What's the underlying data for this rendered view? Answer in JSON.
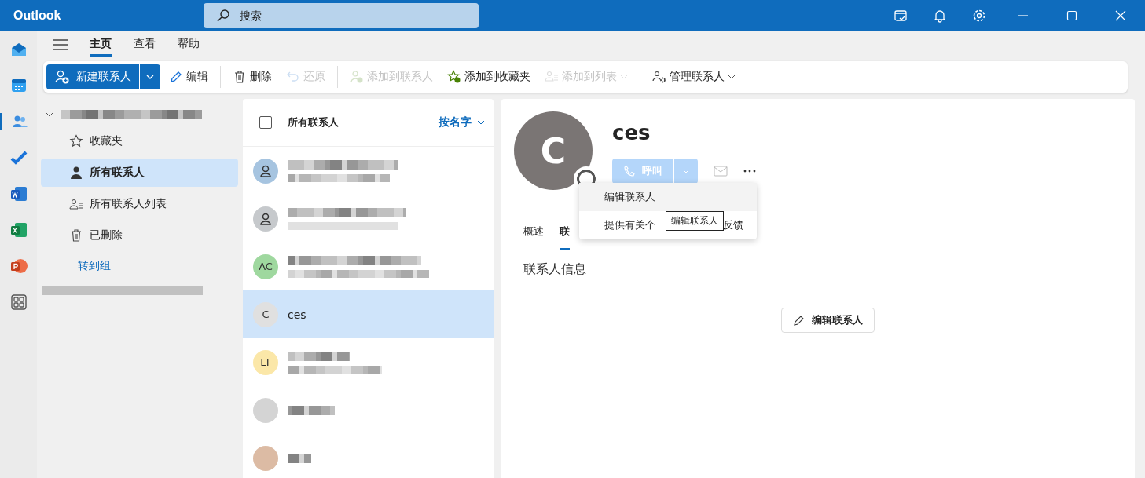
{
  "app": {
    "title": "Outlook"
  },
  "search": {
    "placeholder": "搜索"
  },
  "tabs": [
    {
      "label": "主页",
      "selected": true
    },
    {
      "label": "查看",
      "selected": false
    },
    {
      "label": "帮助",
      "selected": false
    }
  ],
  "ribbon_groups": [
    [
      {
        "kind": "new",
        "label": "新建联系人",
        "disabled": false,
        "dropdown": true
      },
      {
        "kind": "edit",
        "label": "编辑",
        "disabled": false,
        "dropdown": false
      }
    ],
    [
      {
        "kind": "delete",
        "label": "删除",
        "disabled": false,
        "dropdown": false
      },
      {
        "kind": "undo",
        "label": "还原",
        "disabled": true,
        "dropdown": false
      }
    ],
    [
      {
        "kind": "addcontact",
        "label": "添加到联系人",
        "disabled": true,
        "dropdown": false
      },
      {
        "kind": "favorite",
        "label": "添加到收藏夹",
        "disabled": false,
        "dropdown": false
      },
      {
        "kind": "addlist",
        "label": "添加到列表",
        "disabled": true,
        "dropdown": true
      }
    ],
    [
      {
        "kind": "manage",
        "label": "管理联系人",
        "disabled": false,
        "dropdown": true
      }
    ]
  ],
  "nav": {
    "account_expanded": true,
    "items": [
      {
        "kind": "star",
        "label": "收藏夹",
        "selected": false
      },
      {
        "kind": "person",
        "label": "所有联系人",
        "selected": true
      },
      {
        "kind": "list",
        "label": "所有联系人列表",
        "selected": false
      },
      {
        "kind": "trash",
        "label": "已删除",
        "selected": false
      }
    ],
    "goto_group": "转到组"
  },
  "contact_list": {
    "header": "所有联系人",
    "checked": false,
    "sort": "按名字",
    "contacts": [
      {
        "kind": "icon",
        "color": "#a6c4e0",
        "selected": false
      },
      {
        "kind": "icon",
        "color": "#c6c9cc",
        "selected": false
      },
      {
        "kind": "initials",
        "initials": "AC",
        "color": "#9fd89f",
        "selected": false
      },
      {
        "kind": "named",
        "initials": "C",
        "name": "ces",
        "color": "#e0e0e0",
        "selected": true
      },
      {
        "kind": "initials",
        "initials": "LT",
        "color": "#fbe7a8",
        "selected": false
      },
      {
        "kind": "blurred",
        "color": "#d4d4d4",
        "selected": false
      },
      {
        "kind": "blurred",
        "color": "#dcbba4",
        "selected": false
      }
    ]
  },
  "detail": {
    "initials": "C",
    "name": "ces",
    "call": "呼叫",
    "call_disabled": true,
    "tabs": [
      {
        "label": "概述",
        "selected": false
      },
      {
        "label": "联",
        "selected": true
      }
    ],
    "section_title": "联系人信息",
    "edit_button": "编辑联系人"
  },
  "menu": {
    "items": [
      {
        "label": "编辑联系人",
        "hovered": true
      },
      {
        "label": "提供有关个",
        "label_after": "反馈",
        "hovered": false
      }
    ]
  },
  "tooltip": "编辑联系人"
}
